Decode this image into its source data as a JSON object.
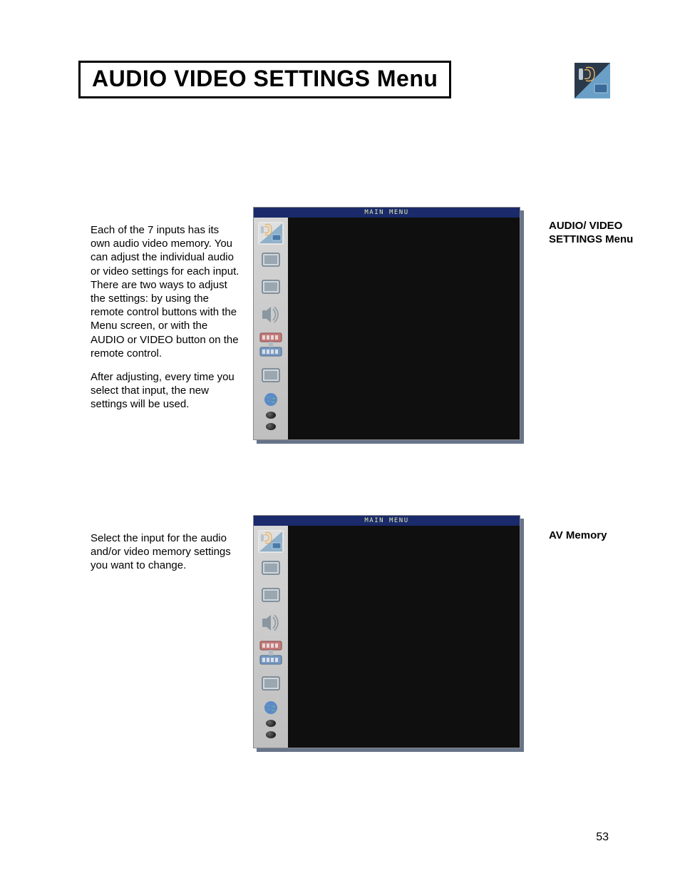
{
  "page": {
    "title": "AUDIO VIDEO SETTINGS Menu",
    "number": "53"
  },
  "section1": {
    "left_p1": "Each of the 7 inputs has its own audio video memory. You can adjust the individual audio or video settings for each input. There are two ways to adjust the settings: by using the remote control buttons with the Menu screen, or with the AUDIO or VIDEO button on the remote control.",
    "left_p2": "After adjusting, every time you select that input, the new settings will be used.",
    "right_heading": "AUDIO/ VIDEO SETTINGS Menu",
    "osd_title": "MAIN MENU"
  },
  "section2": {
    "left_p1": "Select the input for the audio and/or video memory settings you want to change.",
    "right_heading": "AV Memory",
    "osd_title": "MAIN MENU"
  },
  "sidebar_icons": [
    "av-settings-icon",
    "screen-1-icon",
    "screen-2-icon",
    "speaker-icon",
    "captions-icon",
    "screen-3-icon",
    "globe-icon",
    "dot-1-icon",
    "dot-2-icon"
  ]
}
